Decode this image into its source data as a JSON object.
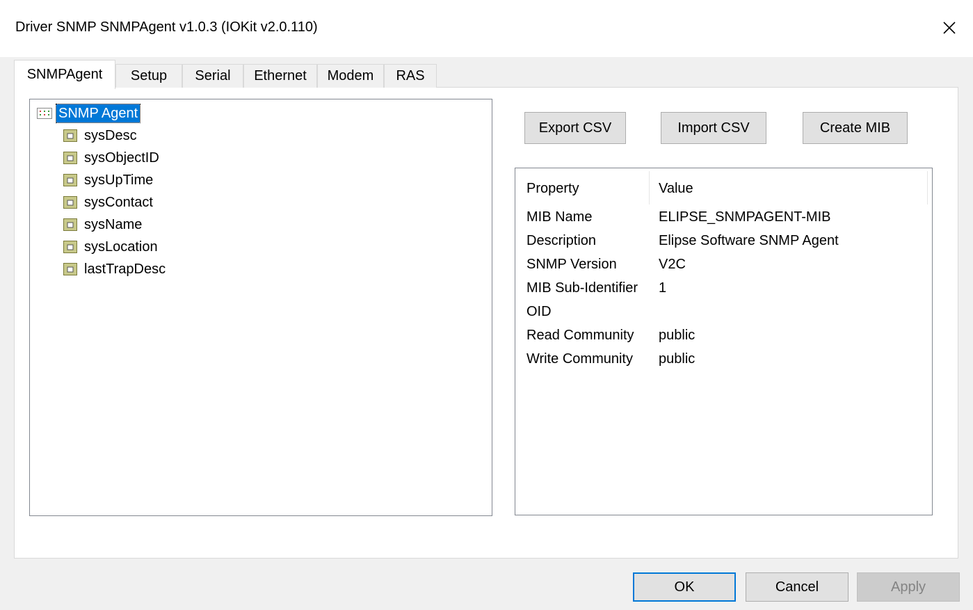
{
  "window": {
    "title": "Driver SNMP SNMPAgent v1.0.3 (IOKit v2.0.110)",
    "close_icon": "close-icon"
  },
  "tabs": [
    {
      "label": "SNMPAgent",
      "active": true
    },
    {
      "label": "Setup",
      "active": false
    },
    {
      "label": "Serial",
      "active": false
    },
    {
      "label": "Ethernet",
      "active": false
    },
    {
      "label": "Modem",
      "active": false
    },
    {
      "label": "RAS",
      "active": false
    }
  ],
  "tree": {
    "root": {
      "label": "SNMP Agent",
      "icon": "agent-icon",
      "selected": true
    },
    "items": [
      {
        "label": "sysDesc",
        "icon": "folder-icon"
      },
      {
        "label": "sysObjectID",
        "icon": "folder-icon"
      },
      {
        "label": "sysUpTime",
        "icon": "folder-icon"
      },
      {
        "label": "sysContact",
        "icon": "folder-icon"
      },
      {
        "label": "sysName",
        "icon": "folder-icon"
      },
      {
        "label": "sysLocation",
        "icon": "folder-icon"
      },
      {
        "label": "lastTrapDesc",
        "icon": "folder-icon"
      }
    ]
  },
  "actions": {
    "export_csv": "Export CSV",
    "import_csv": "Import CSV",
    "create_mib": "Create MIB"
  },
  "properties": {
    "headers": {
      "property": "Property",
      "value": "Value"
    },
    "rows": [
      {
        "name": "MIB Name",
        "value": "ELIPSE_SNMPAGENT-MIB"
      },
      {
        "name": "Description",
        "value": "Elipse Software SNMP Agent"
      },
      {
        "name": "SNMP Version",
        "value": "V2C"
      },
      {
        "name": "MIB Sub-Identifier",
        "value": "1"
      },
      {
        "name": "OID",
        "value": ""
      },
      {
        "name": "Read Community",
        "value": "public"
      },
      {
        "name": "Write Community",
        "value": "public"
      }
    ]
  },
  "footer": {
    "ok": "OK",
    "cancel": "Cancel",
    "apply": "Apply",
    "apply_enabled": false
  },
  "colors": {
    "selection": "#0078d7",
    "folder": "#c8c98a",
    "default_button_border": "#0078d7"
  }
}
